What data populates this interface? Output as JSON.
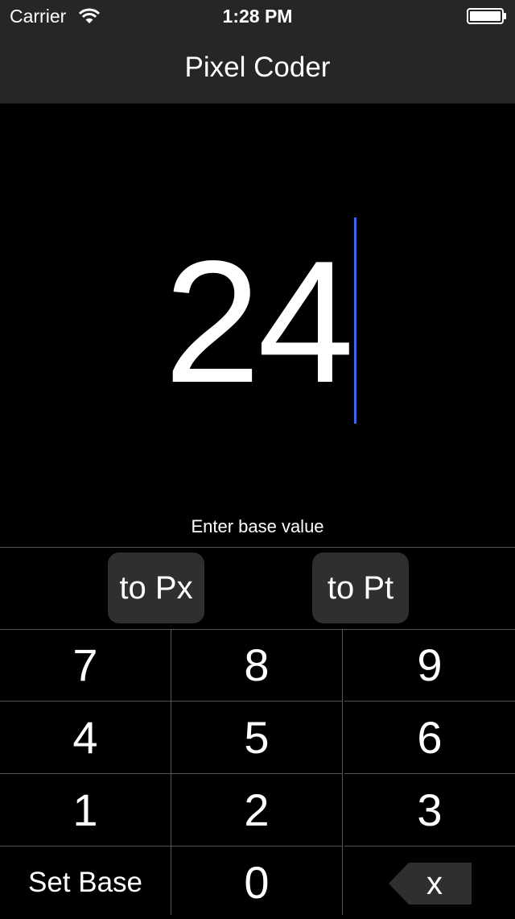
{
  "status_bar": {
    "carrier": "Carrier",
    "time": "1:28 PM",
    "wifi_icon": "wifi-icon",
    "battery_icon": "battery-icon"
  },
  "nav": {
    "title": "Pixel Coder"
  },
  "display": {
    "value": "24",
    "hint": "Enter base value",
    "cursor_color": "#3b67ea"
  },
  "convert": {
    "to_px_label": "to Px",
    "to_pt_label": "to Pt"
  },
  "keypad": {
    "keys": [
      "7",
      "8",
      "9",
      "4",
      "5",
      "6",
      "1",
      "2",
      "3",
      "Set Base",
      "0",
      "x"
    ]
  },
  "colors": {
    "background": "#000000",
    "bar": "#262626",
    "button": "#2f2f2f",
    "divider": "#555555"
  }
}
